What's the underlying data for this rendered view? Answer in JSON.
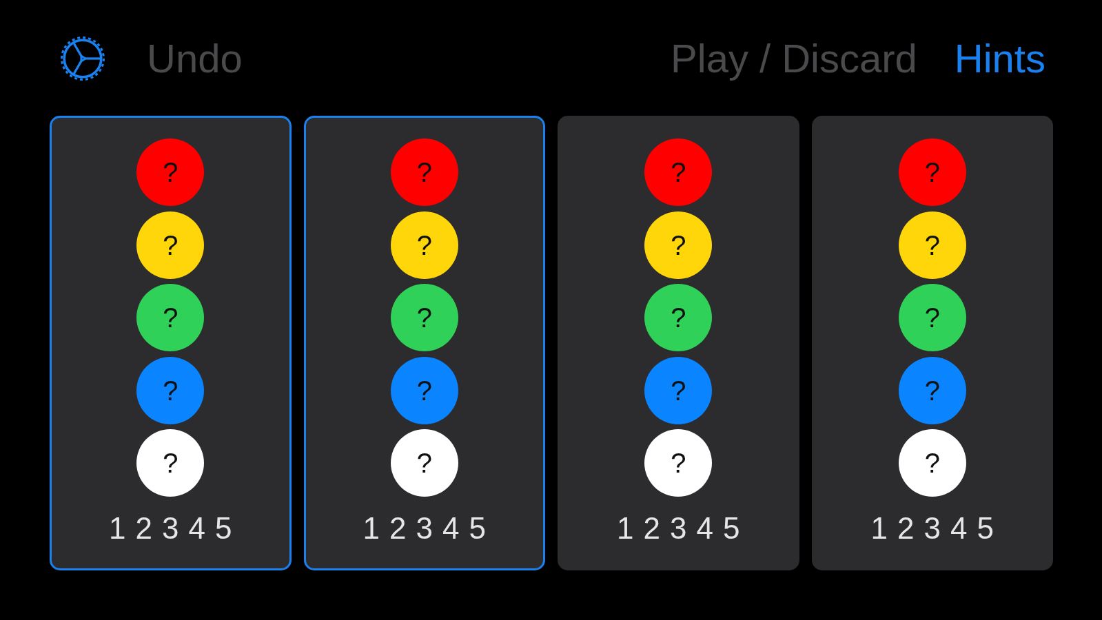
{
  "toolbar": {
    "undo": {
      "label": "Undo",
      "disabled": true
    },
    "modes": [
      {
        "label": "Play / Discard",
        "selected": false
      },
      {
        "label": "Hints",
        "selected": true
      }
    ]
  },
  "cards": [
    {
      "selected": true,
      "colors": [
        {
          "label": "?",
          "color": "#ff0000"
        },
        {
          "label": "?",
          "color": "#ffd60a"
        },
        {
          "label": "?",
          "color": "#30d158"
        },
        {
          "label": "?",
          "color": "#0a84ff"
        },
        {
          "label": "?",
          "color": "#ffffff"
        }
      ],
      "numbers": [
        "1",
        "2",
        "3",
        "4",
        "5"
      ]
    },
    {
      "selected": true,
      "colors": [
        {
          "label": "?",
          "color": "#ff0000"
        },
        {
          "label": "?",
          "color": "#ffd60a"
        },
        {
          "label": "?",
          "color": "#30d158"
        },
        {
          "label": "?",
          "color": "#0a84ff"
        },
        {
          "label": "?",
          "color": "#ffffff"
        }
      ],
      "numbers": [
        "1",
        "2",
        "3",
        "4",
        "5"
      ]
    },
    {
      "selected": false,
      "colors": [
        {
          "label": "?",
          "color": "#ff0000"
        },
        {
          "label": "?",
          "color": "#ffd60a"
        },
        {
          "label": "?",
          "color": "#30d158"
        },
        {
          "label": "?",
          "color": "#0a84ff"
        },
        {
          "label": "?",
          "color": "#ffffff"
        }
      ],
      "numbers": [
        "1",
        "2",
        "3",
        "4",
        "5"
      ]
    },
    {
      "selected": false,
      "colors": [
        {
          "label": "?",
          "color": "#ff0000"
        },
        {
          "label": "?",
          "color": "#ffd60a"
        },
        {
          "label": "?",
          "color": "#30d158"
        },
        {
          "label": "?",
          "color": "#0a84ff"
        },
        {
          "label": "?",
          "color": "#ffffff"
        }
      ],
      "numbers": [
        "1",
        "2",
        "3",
        "4",
        "5"
      ]
    }
  ]
}
